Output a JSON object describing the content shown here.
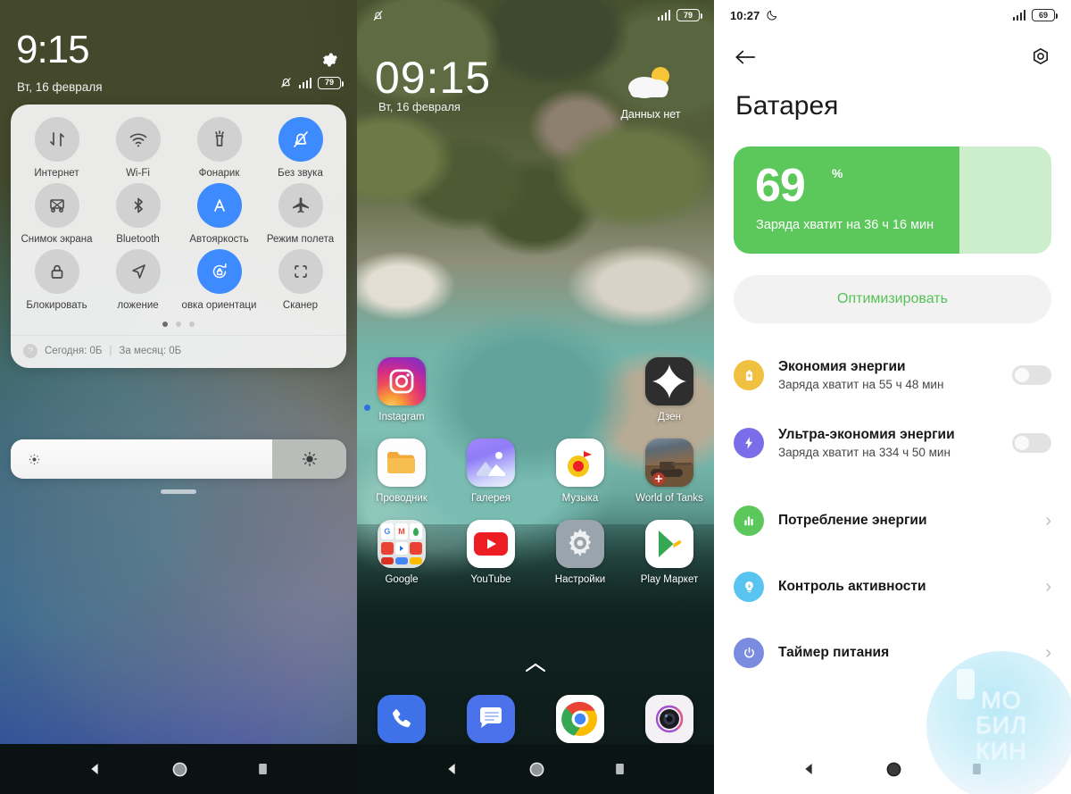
{
  "left_panel": {
    "status": {
      "clock": "9:15",
      "date": "Вт, 16 февраля",
      "battery_percent": "79",
      "icons": [
        "gear-icon",
        "bell-muted-icon",
        "signal-icon",
        "battery-icon"
      ]
    },
    "quick_settings": {
      "tiles": [
        {
          "label": "Интернет",
          "icon": "data-transfer-icon",
          "active": false
        },
        {
          "label": "Wi-Fi",
          "icon": "wifi-icon",
          "active": false,
          "suffix": "▰"
        },
        {
          "label": "Фонарик",
          "icon": "flashlight-icon",
          "active": false
        },
        {
          "label": "Без звука",
          "icon": "bell-muted-icon",
          "active": true
        },
        {
          "label": "Снимок экрана",
          "icon": "screenshot-icon",
          "active": false
        },
        {
          "label": "Bluetooth",
          "icon": "bluetooth-icon",
          "active": false,
          "suffix": "▰"
        },
        {
          "label": "Автояркость",
          "icon": "auto-brightness-icon",
          "active": true
        },
        {
          "label": "Режим полета",
          "icon": "airplane-icon",
          "active": false
        },
        {
          "label": "Блокировать",
          "icon": "lock-icon",
          "active": false
        },
        {
          "label": "ложение",
          "icon": "location-icon",
          "active": false
        },
        {
          "label": "овка ориентаци",
          "icon": "rotation-lock-icon",
          "active": true
        },
        {
          "label": "Сканер",
          "icon": "scanner-icon",
          "active": false
        }
      ],
      "page_dots": 3,
      "active_page": 1,
      "data_today": "Сегодня: 0Б",
      "data_separator": "|",
      "data_month": "За месяц: 0Б",
      "help_icon": "question-icon"
    },
    "brightness": {
      "level_percent": 78,
      "low_icon": "brightness-low-icon",
      "high_icon": "brightness-high-icon"
    }
  },
  "middle_panel": {
    "status": {
      "bell_muted_icon": "bell-muted-icon",
      "battery_percent": "79"
    },
    "clock": "09:15",
    "date": "Вт, 16 февраля",
    "weather": {
      "text": "Данных нет",
      "icon": "sun-cloud-icon"
    },
    "apps_row1": [
      {
        "label": "Instagram",
        "icon": "instagram-icon",
        "badge": true
      },
      {
        "label": "",
        "icon": "empty-slot",
        "hidden": true
      },
      {
        "label": "",
        "icon": "empty-slot",
        "hidden": true
      },
      {
        "label": "Дзен",
        "icon": "dzen-icon"
      }
    ],
    "apps_row2": [
      {
        "label": "Проводник",
        "icon": "file-manager-icon"
      },
      {
        "label": "Галерея",
        "icon": "gallery-icon"
      },
      {
        "label": "Музыка",
        "icon": "music-icon"
      },
      {
        "label": "World of Tanks",
        "icon": "world-of-tanks-icon"
      }
    ],
    "apps_row3": [
      {
        "label": "Google",
        "icon": "google-folder-icon"
      },
      {
        "label": "YouTube",
        "icon": "youtube-icon"
      },
      {
        "label": "Настройки",
        "icon": "settings-gear-icon"
      },
      {
        "label": "Play Маркет",
        "icon": "play-store-icon"
      }
    ],
    "app_drawer_arrow": "chevron-up-icon",
    "dock": [
      {
        "label": "phone",
        "icon": "phone-icon"
      },
      {
        "label": "messages",
        "icon": "messages-icon"
      },
      {
        "label": "chrome",
        "icon": "chrome-icon"
      },
      {
        "label": "camera",
        "icon": "camera-icon"
      }
    ]
  },
  "right_panel": {
    "status": {
      "clock": "10:27",
      "dnd_icon": "moon-icon",
      "battery_percent": "69"
    },
    "back_icon": "arrow-left-icon",
    "settings_icon": "gear-hex-icon",
    "title": "Батарея",
    "battery_card": {
      "value": "69",
      "unit": "%",
      "subtitle": "Заряда хватит на 36 ч 16 мин",
      "fill_percent": 71,
      "fill_color": "#5cc85c",
      "track_color": "#cdeecd"
    },
    "optimize_button": "Оптимизировать",
    "items": [
      {
        "title": "Экономия энергии",
        "subtitle": "Заряда хватит на 55 ч 48 мин",
        "icon": "battery-saver-icon",
        "icon_color": "#f0c040",
        "control": "toggle",
        "enabled": false
      },
      {
        "title": "Ультра-экономия энергии",
        "subtitle": "Заряда хватит на 334 ч 50 мин",
        "icon": "bolt-icon",
        "icon_color": "#7b6ce8",
        "control": "toggle",
        "enabled": false
      },
      {
        "title": "Потребление энергии",
        "subtitle": "",
        "icon": "bar-chart-icon",
        "icon_color": "#5cc85c",
        "control": "chevron"
      },
      {
        "title": "Контроль активности",
        "subtitle": "",
        "icon": "bulb-bolt-icon",
        "icon_color": "#59c4f0",
        "control": "chevron"
      },
      {
        "title": "Таймер питания",
        "subtitle": "",
        "icon": "power-icon",
        "icon_color": "#7b8ce0",
        "control": "chevron"
      }
    ],
    "watermark": {
      "line1": "МО",
      "line2": "БИЛ",
      "line3": "КИН"
    }
  },
  "navigation": {
    "back_icon": "nav-back-triangle",
    "home_icon": "nav-home-circle",
    "recents_icon": "nav-recents-square"
  }
}
